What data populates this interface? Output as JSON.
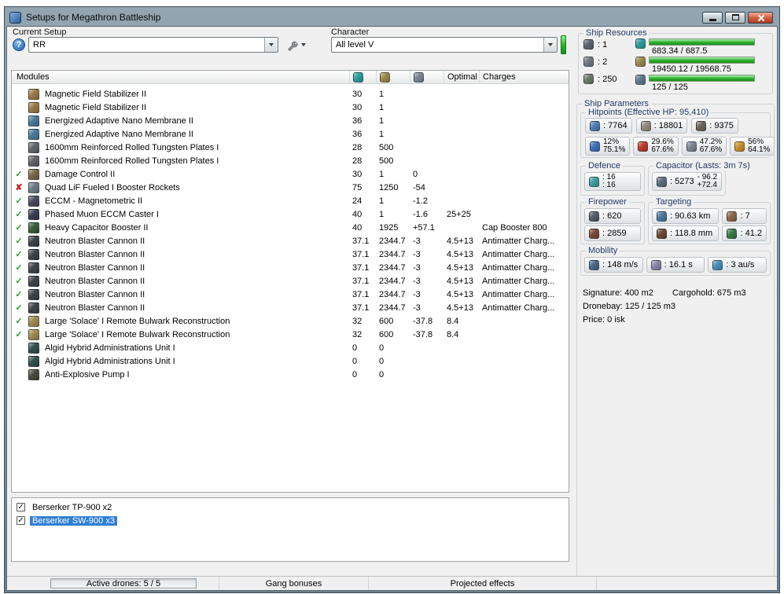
{
  "window": {
    "title": "Setups for Megathron Battleship"
  },
  "toolbar": {
    "current_setup_label": "Current Setup",
    "setup_value": "RR",
    "character_label": "Character",
    "character_value": "All level V",
    "help_glyph": "?"
  },
  "modules_table": {
    "columns": {
      "modules": "Modules",
      "optimal": "Optimal",
      "charges": "Charges"
    },
    "column_icons": [
      {
        "icon": "cpu-column-icon",
        "color": "#2f9e9e"
      },
      {
        "icon": "powergrid-column-icon",
        "color": "#9a8a52"
      },
      {
        "icon": "capacitor-column-icon",
        "color": "#7a8794"
      }
    ],
    "rows": [
      {
        "status": "",
        "icon": "magnetic-field-stabilizer-icon",
        "color": "#9b7b4a",
        "name": "Magnetic Field Stabilizer II",
        "cpu": "30",
        "pg": "1",
        "cap": "",
        "optimal": "",
        "charges": ""
      },
      {
        "status": "",
        "icon": "magnetic-field-stabilizer-icon",
        "color": "#9b7b4a",
        "name": "Magnetic Field Stabilizer II",
        "cpu": "30",
        "pg": "1",
        "cap": "",
        "optimal": "",
        "charges": ""
      },
      {
        "status": "",
        "icon": "adaptive-nano-membrane-icon",
        "color": "#4a7b9b",
        "name": "Energized Adaptive Nano Membrane II",
        "cpu": "36",
        "pg": "1",
        "cap": "",
        "optimal": "",
        "charges": ""
      },
      {
        "status": "",
        "icon": "adaptive-nano-membrane-icon",
        "color": "#4a7b9b",
        "name": "Energized Adaptive Nano Membrane II",
        "cpu": "36",
        "pg": "1",
        "cap": "",
        "optimal": "",
        "charges": ""
      },
      {
        "status": "",
        "icon": "armor-plate-icon",
        "color": "#62656a",
        "name": "1600mm Reinforced Rolled Tungsten Plates I",
        "cpu": "28",
        "pg": "500",
        "cap": "",
        "optimal": "",
        "charges": ""
      },
      {
        "status": "",
        "icon": "armor-plate-icon",
        "color": "#62656a",
        "name": "1600mm Reinforced Rolled Tungsten Plates I",
        "cpu": "28",
        "pg": "500",
        "cap": "",
        "optimal": "",
        "charges": ""
      },
      {
        "status": "active",
        "icon": "damage-control-icon",
        "color": "#7a6a4a",
        "name": "Damage Control II",
        "cpu": "30",
        "pg": "1",
        "cap": "0",
        "optimal": "",
        "charges": ""
      },
      {
        "status": "offline",
        "icon": "booster-rockets-icon",
        "color": "#6f7d88",
        "name": "Quad LiF Fueled I Booster Rockets",
        "cpu": "75",
        "pg": "1250",
        "cap": "-54",
        "optimal": "",
        "charges": ""
      },
      {
        "status": "active",
        "icon": "eccm-icon",
        "color": "#4c4c60",
        "name": "ECCM - Magnetometric II",
        "cpu": "24",
        "pg": "1",
        "cap": "-1.2",
        "optimal": "",
        "charges": ""
      },
      {
        "status": "active",
        "icon": "eccm-caster-icon",
        "color": "#3d3d55",
        "name": "Phased Muon ECCM Caster I",
        "cpu": "40",
        "pg": "1",
        "cap": "-1.6",
        "optimal": "25+25",
        "charges": ""
      },
      {
        "status": "active",
        "icon": "capacitor-booster-icon",
        "color": "#3a5f3a",
        "name": "Heavy Capacitor Booster II",
        "cpu": "40",
        "pg": "1925",
        "cap": "+57.1",
        "optimal": "",
        "charges": "Cap Booster 800"
      },
      {
        "status": "active",
        "icon": "blaster-cannon-icon",
        "color": "#3f444a",
        "name": "Neutron Blaster Cannon II",
        "cpu": "37.1",
        "pg": "2344.7",
        "cap": "-3",
        "optimal": "4.5+13",
        "charges": "Antimatter Charg..."
      },
      {
        "status": "active",
        "icon": "blaster-cannon-icon",
        "color": "#3f444a",
        "name": "Neutron Blaster Cannon II",
        "cpu": "37.1",
        "pg": "2344.7",
        "cap": "-3",
        "optimal": "4.5+13",
        "charges": "Antimatter Charg..."
      },
      {
        "status": "active",
        "icon": "blaster-cannon-icon",
        "color": "#3f444a",
        "name": "Neutron Blaster Cannon II",
        "cpu": "37.1",
        "pg": "2344.7",
        "cap": "-3",
        "optimal": "4.5+13",
        "charges": "Antimatter Charg..."
      },
      {
        "status": "active",
        "icon": "blaster-cannon-icon",
        "color": "#3f444a",
        "name": "Neutron Blaster Cannon II",
        "cpu": "37.1",
        "pg": "2344.7",
        "cap": "-3",
        "optimal": "4.5+13",
        "charges": "Antimatter Charg..."
      },
      {
        "status": "active",
        "icon": "blaster-cannon-icon",
        "color": "#3f444a",
        "name": "Neutron Blaster Cannon II",
        "cpu": "37.1",
        "pg": "2344.7",
        "cap": "-3",
        "optimal": "4.5+13",
        "charges": "Antimatter Charg..."
      },
      {
        "status": "active",
        "icon": "blaster-cannon-icon",
        "color": "#3f444a",
        "name": "Neutron Blaster Cannon II",
        "cpu": "37.1",
        "pg": "2344.7",
        "cap": "-3",
        "optimal": "4.5+13",
        "charges": "Antimatter Charg..."
      },
      {
        "status": "active",
        "icon": "remote-armor-repair-icon",
        "color": "#a08a50",
        "name": "Large 'Solace' I Remote Bulwark Reconstruction",
        "cpu": "32",
        "pg": "600",
        "cap": "-37.8",
        "optimal": "8.4",
        "charges": ""
      },
      {
        "status": "active",
        "icon": "remote-armor-repair-icon",
        "color": "#a08a50",
        "name": "Large 'Solace' I Remote Bulwark Reconstruction",
        "cpu": "32",
        "pg": "600",
        "cap": "-37.8",
        "optimal": "8.4",
        "charges": ""
      },
      {
        "status": "",
        "icon": "rig-icon",
        "color": "#35504f",
        "name": "Algid Hybrid Administrations Unit I",
        "cpu": "0",
        "pg": "0",
        "cap": "",
        "optimal": "",
        "charges": ""
      },
      {
        "status": "",
        "icon": "rig-icon",
        "color": "#35504f",
        "name": "Algid Hybrid Administrations Unit I",
        "cpu": "0",
        "pg": "0",
        "cap": "",
        "optimal": "",
        "charges": ""
      },
      {
        "status": "",
        "icon": "rig-icon",
        "color": "#4a4a42",
        "name": "Anti-Explosive Pump I",
        "cpu": "0",
        "pg": "0",
        "cap": "",
        "optimal": "",
        "charges": ""
      }
    ]
  },
  "drones": {
    "items": [
      {
        "label": "Berserker TP-900 x2",
        "checked": true,
        "selected": false
      },
      {
        "label": "Berserker SW-900 x3",
        "checked": true,
        "selected": true
      }
    ]
  },
  "statusbar": {
    "active_drones": "Active drones: 5 / 5",
    "gang_bonuses": "Gang bonuses",
    "projected_effects": "Projected effects"
  },
  "ship_resources": {
    "title": "Ship Resources",
    "slots": [
      {
        "name": "turret-hardpoints",
        "icon": "turret-hardpoints-icon",
        "color": "#5a6670",
        "value": ": 1"
      },
      {
        "name": "launcher-hardpoints",
        "icon": "launcher-hardpoints-icon",
        "color": "#707a84",
        "value": ": 2"
      },
      {
        "name": "calibration",
        "icon": "calibration-icon",
        "color": "#6e7d6a",
        "value": ": 250"
      }
    ],
    "bars": [
      {
        "name": "cpu",
        "icon": "cpu-icon",
        "color": "#2f9e9e",
        "value": "683.34 / 687.5",
        "fill": 99
      },
      {
        "name": "powergrid",
        "icon": "powergrid-icon",
        "color": "#9a8a52",
        "value": "19450.12 / 19568.75",
        "fill": 99
      },
      {
        "name": "drone-bandwidth",
        "icon": "drone-bandwidth-icon",
        "color": "#5f7a8a",
        "value": "125 / 125",
        "fill": 100
      }
    ]
  },
  "ship_parameters": {
    "title": "Ship Parameters",
    "hitpoints": {
      "title": "Hitpoints (Effective HP: 95,410)",
      "values": [
        {
          "name": "shield-hp",
          "icon": "shield-icon",
          "color": "#4f7fb5",
          "value": ": 7764"
        },
        {
          "name": "armor-hp",
          "icon": "armor-icon",
          "color": "#938d82",
          "value": ": 18801"
        },
        {
          "name": "structure-hp",
          "icon": "structure-icon",
          "color": "#6e675f",
          "value": ": 9375"
        }
      ],
      "resists": [
        {
          "name": "em-resist",
          "icon": "em-resist-icon",
          "color": "#3f6fba",
          "shield": "12%",
          "armor": "75.1%"
        },
        {
          "name": "thermal-resist",
          "icon": "thermal-resist-icon",
          "color": "#c03a2b",
          "shield": "29.6%",
          "armor": "67.6%"
        },
        {
          "name": "kinetic-resist",
          "icon": "kinetic-resist-icon",
          "color": "#7d8794",
          "shield": "47.2%",
          "armor": "67.6%"
        },
        {
          "name": "explosive-resist",
          "icon": "explosive-resist-icon",
          "color": "#c8922f",
          "shield": "56%",
          "armor": "64.1%"
        }
      ]
    },
    "defence": {
      "title": "Defence",
      "icon": "shield-booster-icon",
      "color": "#3f9f9f",
      "values": [
        ": 16",
        ": 16"
      ]
    },
    "capacitor": {
      "title": "Capacitor (Lasts: 3m 7s)",
      "icon": "capacitor-icon",
      "color": "#5b6d7d",
      "amount": ": 5273",
      "drain": "- 96.2",
      "recharge": "+72.4"
    },
    "firepower": {
      "title": "Firepower",
      "rows": [
        {
          "name": "turret-dps",
          "icon": "turret-dps-icon",
          "color": "#555d66",
          "value": ": 620"
        },
        {
          "name": "drone-dps",
          "icon": "drone-dps-icon",
          "color": "#7a4a3a",
          "value": ": 2859"
        }
      ]
    },
    "targeting": {
      "title": "Targeting",
      "rows": [
        [
          {
            "name": "targeting-range",
            "icon": "target-range-icon",
            "color": "#4a7a9f",
            "value": ": 90.63 km"
          },
          {
            "name": "max-targets",
            "icon": "max-targets-icon",
            "color": "#8a6a4a",
            "value": ": 7"
          }
        ],
        [
          {
            "name": "scan-resolution",
            "icon": "scan-resolution-icon",
            "color": "#6a4a35",
            "value": ": 118.8 mm"
          },
          {
            "name": "sensor-strength",
            "icon": "sensor-strength-icon",
            "color": "#3a7a4a",
            "value": ": 41.2"
          }
        ]
      ]
    },
    "mobility": {
      "title": "Mobility",
      "items": [
        {
          "name": "max-velocity",
          "icon": "max-velocity-icon",
          "color": "#4a6a8a",
          "value": ": 148 m/s"
        },
        {
          "name": "align-time",
          "icon": "align-time-icon",
          "color": "#8888aa",
          "value": ": 16.1 s"
        },
        {
          "name": "warp-speed",
          "icon": "warp-speed-icon",
          "color": "#4a90c0",
          "value": ": 3 au/s"
        }
      ]
    },
    "signature": "Signature: 400 m2",
    "cargohold": "Cargohold: 675 m3",
    "dronebay": "Dronebay: 125 / 125 m3",
    "price": "Price: 0 isk"
  }
}
